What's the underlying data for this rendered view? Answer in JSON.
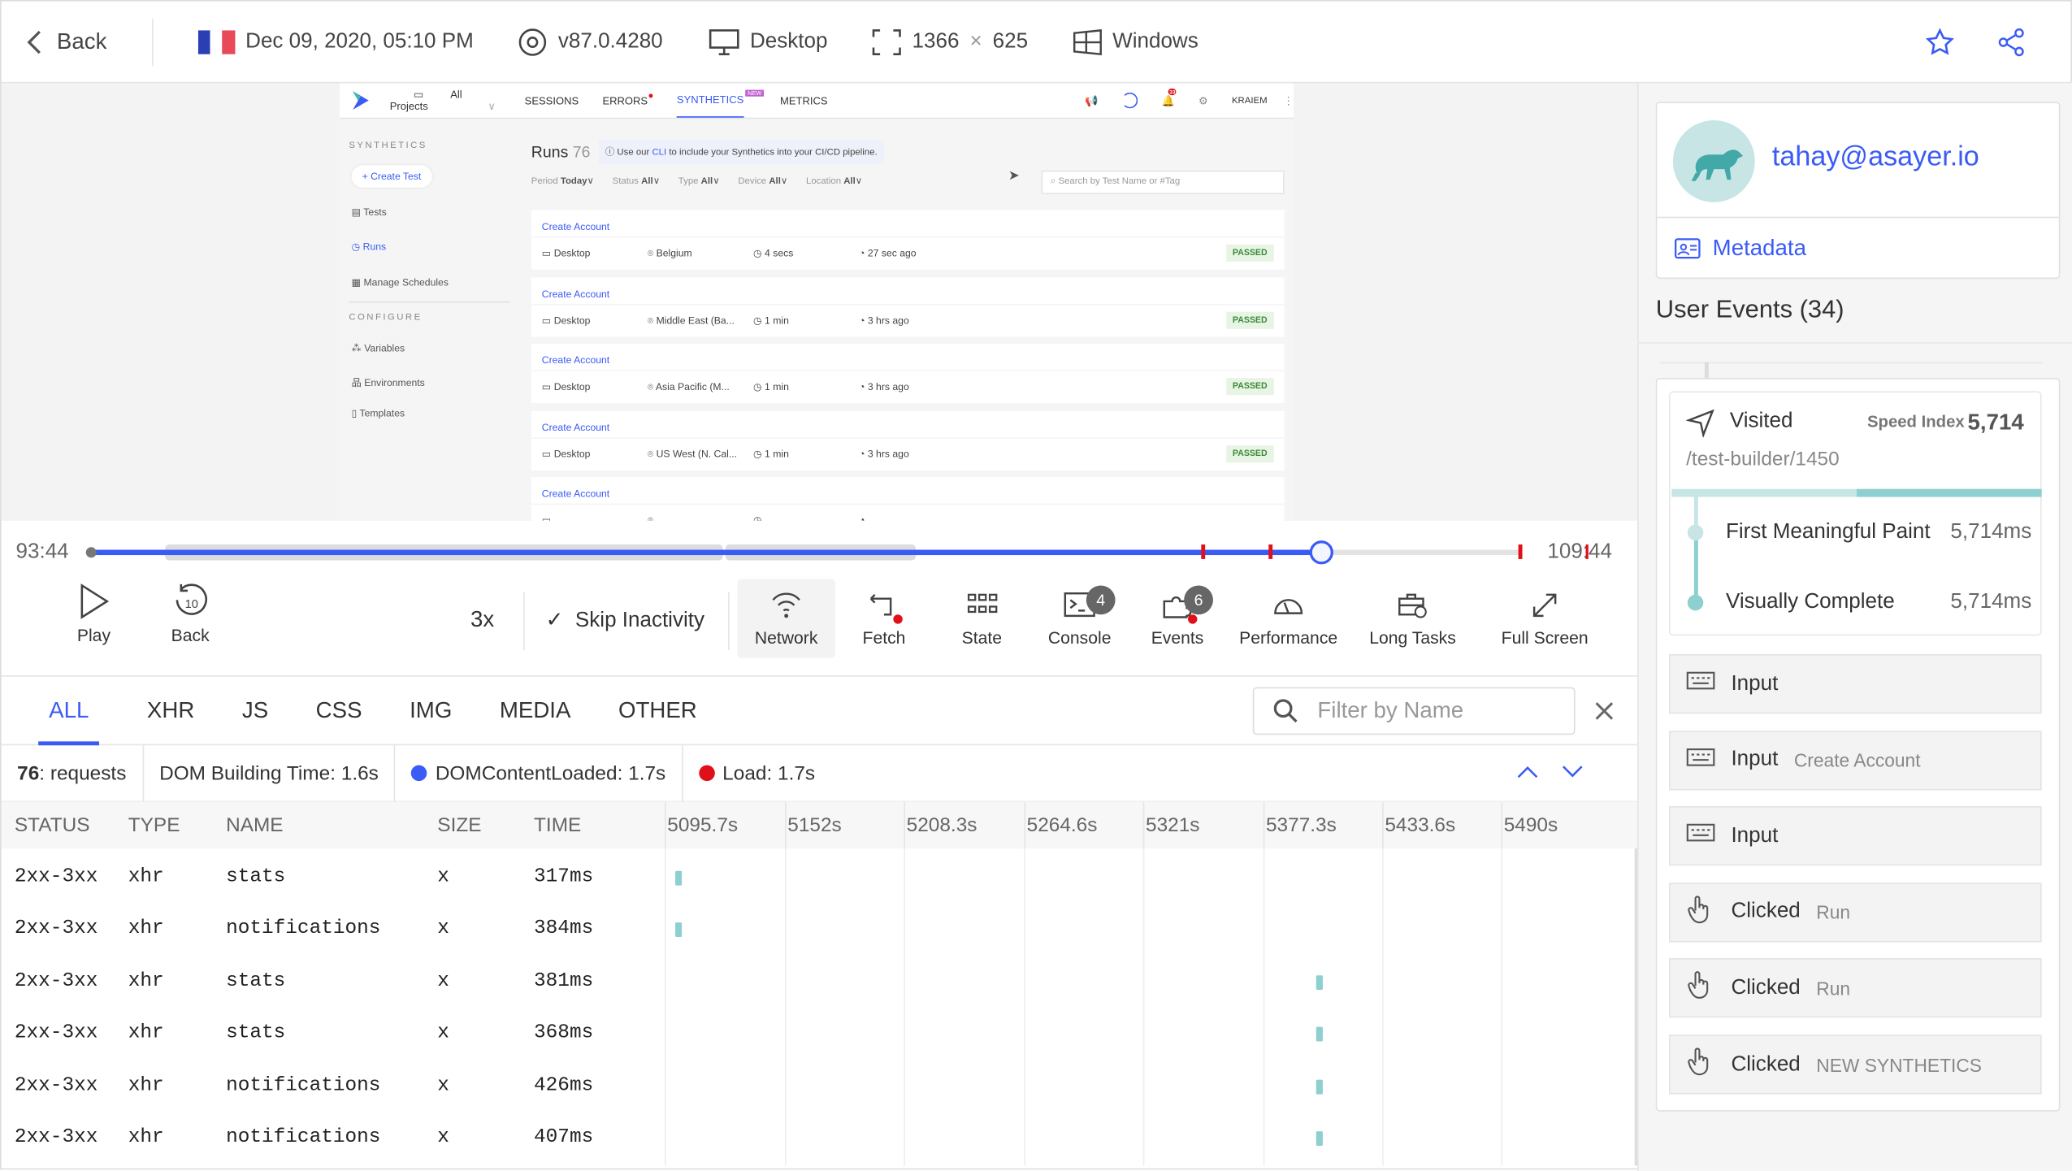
{
  "topbar": {
    "back": "Back",
    "flag": "France",
    "date": "Dec 09, 2020, 05:10 PM",
    "browser": "v87.0.4280",
    "device": "Desktop",
    "width": "1366",
    "times": "×",
    "height": "625",
    "os": "Windows"
  },
  "embedded": {
    "nav": {
      "project": "All Projects",
      "tabs": [
        "SESSIONS",
        "ERRORS",
        "SYNTHETICS",
        "METRICS"
      ],
      "new_badge": "NEW",
      "user": "KRAIEM",
      "notif_count": "33"
    },
    "sidebar": {
      "section1": "SYNTHETICS",
      "create": "+ Create Test",
      "items": [
        "Tests",
        "Runs",
        "Manage Schedules"
      ],
      "section2": "CONFIGURE",
      "items2": [
        "Variables",
        "Environments",
        "Templates"
      ]
    },
    "title": "Runs",
    "count": "76",
    "hint_pre": "Use our ",
    "hint_link": "CLI",
    "hint_post": " to include your Synthetics into your CI/CD pipeline.",
    "filters": [
      {
        "label": "Period",
        "value": "Today"
      },
      {
        "label": "Status",
        "value": "All"
      },
      {
        "label": "Type",
        "value": "All"
      },
      {
        "label": "Device",
        "value": "All"
      },
      {
        "label": "Location",
        "value": "All"
      }
    ],
    "search_placeholder": "Search by Test Name or #Tag",
    "runs": [
      {
        "name": "Create Account",
        "device": "Desktop",
        "location": "Belgium",
        "duration": "4 secs",
        "ago": "27 sec ago",
        "status": "PASSED"
      },
      {
        "name": "Create Account",
        "device": "Desktop",
        "location": "Middle East (Ba...",
        "duration": "1 min",
        "ago": "3 hrs ago",
        "status": "PASSED"
      },
      {
        "name": "Create Account",
        "device": "Desktop",
        "location": "Asia Pacific (M...",
        "duration": "1 min",
        "ago": "3 hrs ago",
        "status": "PASSED"
      },
      {
        "name": "Create Account",
        "device": "Desktop",
        "location": "US West (N. Cal...",
        "duration": "1 min",
        "ago": "3 hrs ago",
        "status": "PASSED"
      },
      {
        "name": "Create Account",
        "device": "",
        "location": "",
        "duration": "",
        "ago": "",
        "status": ""
      }
    ]
  },
  "timeline": {
    "start": "93:44",
    "end": "109:44",
    "progress": 0.86
  },
  "controls": {
    "play": "Play",
    "back": "Back",
    "back_seconds": "10",
    "speed": "3x",
    "skip": "Skip Inactivity",
    "tools": [
      "Network",
      "Fetch",
      "State",
      "Console",
      "Events",
      "Performance",
      "Long Tasks",
      "Full Screen"
    ],
    "console_count": "4",
    "events_count": "6"
  },
  "network": {
    "tabs": [
      "ALL",
      "XHR",
      "JS",
      "CSS",
      "IMG",
      "MEDIA",
      "OTHER"
    ],
    "filter_placeholder": "Filter by Name",
    "requests_count": "76",
    "requests_label": ": requests",
    "dom_building": "DOM Building Time: 1.6s",
    "dcl": "DOMContentLoaded: 1.7s",
    "load": "Load: 1.7s",
    "columns": [
      "STATUS",
      "TYPE",
      "NAME",
      "SIZE",
      "TIME"
    ],
    "ticks": [
      "5095.7s",
      "5152s",
      "5208.3s",
      "5264.6s",
      "5321s",
      "5377.3s",
      "5433.6s",
      "5490s"
    ],
    "rows": [
      {
        "status": "2xx-3xx",
        "type": "xhr",
        "name": "stats",
        "size": "x",
        "time": "317ms",
        "start": 5095.7
      },
      {
        "status": "2xx-3xx",
        "type": "xhr",
        "name": "notifications",
        "size": "x",
        "time": "384ms",
        "start": 5095.7
      },
      {
        "status": "2xx-3xx",
        "type": "xhr",
        "name": "stats",
        "size": "x",
        "time": "381ms",
        "start": 5398
      },
      {
        "status": "2xx-3xx",
        "type": "xhr",
        "name": "stats",
        "size": "x",
        "time": "368ms",
        "start": 5398
      },
      {
        "status": "2xx-3xx",
        "type": "xhr",
        "name": "notifications",
        "size": "x",
        "time": "426ms",
        "start": 5398
      },
      {
        "status": "2xx-3xx",
        "type": "xhr",
        "name": "notifications",
        "size": "x",
        "time": "407ms",
        "start": 5398
      }
    ]
  },
  "user": {
    "email": "tahay@asayer.io",
    "metadata": "Metadata",
    "events_title": "User Events (34)"
  },
  "visited": {
    "label": "Visited",
    "speed_label": "Speed Index",
    "speed": "5,714",
    "path": "/test-builder/1450",
    "fmp_label": "First Meaningful Paint",
    "fmp": "5,714ms",
    "vc_label": "Visually Complete",
    "vc": "5,714ms"
  },
  "events": [
    {
      "type": "Input",
      "detail": ""
    },
    {
      "type": "Input",
      "detail": "Create Account"
    },
    {
      "type": "Input",
      "detail": ""
    },
    {
      "type": "Clicked",
      "detail": "Run"
    },
    {
      "type": "Clicked",
      "detail": "Run"
    },
    {
      "type": "Clicked",
      "detail": "NEW SYNTHETICS"
    }
  ],
  "colors": {
    "accent": "#3a5bf5",
    "teal": "#8ecfcf",
    "red": "#e0101a"
  }
}
